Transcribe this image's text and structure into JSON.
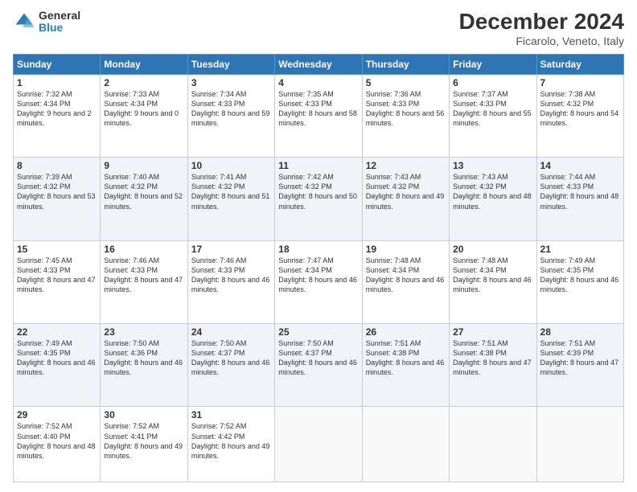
{
  "header": {
    "logo_general": "General",
    "logo_blue": "Blue",
    "title": "December 2024",
    "subtitle": "Ficarolo, Veneto, Italy"
  },
  "days": [
    "Sunday",
    "Monday",
    "Tuesday",
    "Wednesday",
    "Thursday",
    "Friday",
    "Saturday"
  ],
  "weeks": [
    [
      {
        "day": "1",
        "sunrise": "7:32 AM",
        "sunset": "4:34 PM",
        "daylight": "9 hours and 2 minutes."
      },
      {
        "day": "2",
        "sunrise": "7:33 AM",
        "sunset": "4:34 PM",
        "daylight": "9 hours and 0 minutes."
      },
      {
        "day": "3",
        "sunrise": "7:34 AM",
        "sunset": "4:33 PM",
        "daylight": "8 hours and 59 minutes."
      },
      {
        "day": "4",
        "sunrise": "7:35 AM",
        "sunset": "4:33 PM",
        "daylight": "8 hours and 58 minutes."
      },
      {
        "day": "5",
        "sunrise": "7:36 AM",
        "sunset": "4:33 PM",
        "daylight": "8 hours and 56 minutes."
      },
      {
        "day": "6",
        "sunrise": "7:37 AM",
        "sunset": "4:33 PM",
        "daylight": "8 hours and 55 minutes."
      },
      {
        "day": "7",
        "sunrise": "7:38 AM",
        "sunset": "4:32 PM",
        "daylight": "8 hours and 54 minutes."
      }
    ],
    [
      {
        "day": "8",
        "sunrise": "7:39 AM",
        "sunset": "4:32 PM",
        "daylight": "8 hours and 53 minutes."
      },
      {
        "day": "9",
        "sunrise": "7:40 AM",
        "sunset": "4:32 PM",
        "daylight": "8 hours and 52 minutes."
      },
      {
        "day": "10",
        "sunrise": "7:41 AM",
        "sunset": "4:32 PM",
        "daylight": "8 hours and 51 minutes."
      },
      {
        "day": "11",
        "sunrise": "7:42 AM",
        "sunset": "4:32 PM",
        "daylight": "8 hours and 50 minutes."
      },
      {
        "day": "12",
        "sunrise": "7:43 AM",
        "sunset": "4:32 PM",
        "daylight": "8 hours and 49 minutes."
      },
      {
        "day": "13",
        "sunrise": "7:43 AM",
        "sunset": "4:32 PM",
        "daylight": "8 hours and 48 minutes."
      },
      {
        "day": "14",
        "sunrise": "7:44 AM",
        "sunset": "4:33 PM",
        "daylight": "8 hours and 48 minutes."
      }
    ],
    [
      {
        "day": "15",
        "sunrise": "7:45 AM",
        "sunset": "4:33 PM",
        "daylight": "8 hours and 47 minutes."
      },
      {
        "day": "16",
        "sunrise": "7:46 AM",
        "sunset": "4:33 PM",
        "daylight": "8 hours and 47 minutes."
      },
      {
        "day": "17",
        "sunrise": "7:46 AM",
        "sunset": "4:33 PM",
        "daylight": "8 hours and 46 minutes."
      },
      {
        "day": "18",
        "sunrise": "7:47 AM",
        "sunset": "4:34 PM",
        "daylight": "8 hours and 46 minutes."
      },
      {
        "day": "19",
        "sunrise": "7:48 AM",
        "sunset": "4:34 PM",
        "daylight": "8 hours and 46 minutes."
      },
      {
        "day": "20",
        "sunrise": "7:48 AM",
        "sunset": "4:34 PM",
        "daylight": "8 hours and 46 minutes."
      },
      {
        "day": "21",
        "sunrise": "7:49 AM",
        "sunset": "4:35 PM",
        "daylight": "8 hours and 46 minutes."
      }
    ],
    [
      {
        "day": "22",
        "sunrise": "7:49 AM",
        "sunset": "4:35 PM",
        "daylight": "8 hours and 46 minutes."
      },
      {
        "day": "23",
        "sunrise": "7:50 AM",
        "sunset": "4:36 PM",
        "daylight": "8 hours and 46 minutes."
      },
      {
        "day": "24",
        "sunrise": "7:50 AM",
        "sunset": "4:37 PM",
        "daylight": "8 hours and 46 minutes."
      },
      {
        "day": "25",
        "sunrise": "7:50 AM",
        "sunset": "4:37 PM",
        "daylight": "8 hours and 46 minutes."
      },
      {
        "day": "26",
        "sunrise": "7:51 AM",
        "sunset": "4:38 PM",
        "daylight": "8 hours and 46 minutes."
      },
      {
        "day": "27",
        "sunrise": "7:51 AM",
        "sunset": "4:38 PM",
        "daylight": "8 hours and 47 minutes."
      },
      {
        "day": "28",
        "sunrise": "7:51 AM",
        "sunset": "4:39 PM",
        "daylight": "8 hours and 47 minutes."
      }
    ],
    [
      {
        "day": "29",
        "sunrise": "7:52 AM",
        "sunset": "4:40 PM",
        "daylight": "8 hours and 48 minutes."
      },
      {
        "day": "30",
        "sunrise": "7:52 AM",
        "sunset": "4:41 PM",
        "daylight": "8 hours and 49 minutes."
      },
      {
        "day": "31",
        "sunrise": "7:52 AM",
        "sunset": "4:42 PM",
        "daylight": "8 hours and 49 minutes."
      },
      null,
      null,
      null,
      null
    ]
  ],
  "labels": {
    "sunrise": "Sunrise:",
    "sunset": "Sunset:",
    "daylight": "Daylight:"
  }
}
